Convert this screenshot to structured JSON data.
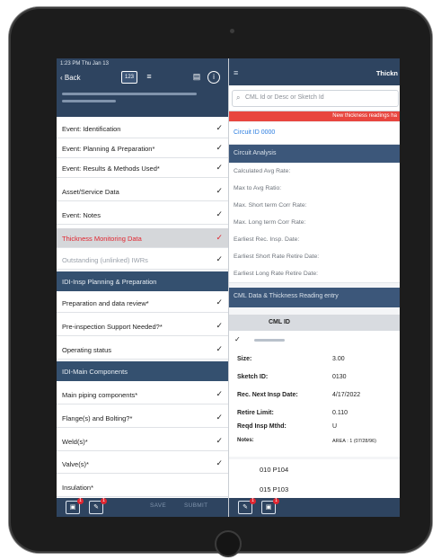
{
  "status_bar": {
    "time": "1:23 PM  Thu Jan 13"
  },
  "left_header": {
    "back_label": "‹ Back",
    "calendar_icon_text": "123",
    "list_icon": "list-icon",
    "doc_icon": "document-icon",
    "info_icon": "info-icon"
  },
  "nav_items": [
    {
      "label": "Event: Identification",
      "check": "✓"
    },
    {
      "label": "Event: Planning & Preparation*",
      "check": "✓"
    },
    {
      "label": "Event: Results & Methods Used*",
      "check": "✓"
    },
    {
      "label": "Asset/Service Data",
      "check": "✓"
    },
    {
      "label": "Event: Notes",
      "check": "✓"
    },
    {
      "label": "Thickness Monitoring Data",
      "check": "✓"
    },
    {
      "label": "Outstanding (unlinked) IWRs",
      "check": "✓"
    }
  ],
  "section_1": {
    "label": "IDI-Insp Planning & Preparation"
  },
  "nav_items_2": [
    {
      "label": "Preparation and data review*",
      "check": "✓"
    },
    {
      "label": "Pre-inspection Support Needed?*",
      "check": "✓"
    },
    {
      "label": "Operating status",
      "check": "✓"
    }
  ],
  "section_2": {
    "label": "IDI-Main Components"
  },
  "nav_items_3": [
    {
      "label": "Main piping components*",
      "check": "✓"
    },
    {
      "label": "Flange(s) and Bolting?*",
      "check": "✓"
    },
    {
      "label": "Weld(s)*",
      "check": "✓"
    },
    {
      "label": "Valve(s)*",
      "check": "✓"
    },
    {
      "label": "Insulation*",
      "check": ""
    }
  ],
  "left_footer": {
    "save": "SAVE",
    "submit": "SUBMIT",
    "badge_1": "1",
    "badge_2": "1"
  },
  "right_header": {
    "title": "Thickn"
  },
  "search": {
    "placeholder": "CML Id or Desc or Sketch Id"
  },
  "alert": {
    "text": "New thickness readings ha"
  },
  "circuit_analysis": {
    "header": "Circuit Analysis",
    "rows": [
      "Calculated Avg Rate:",
      "Max to Avg Ratio:",
      "Max. Short term Corr Rate:",
      "Max. Long term Corr Rate:",
      "Earliest Rec. Insp. Date:",
      "Earliest Short Rate Retire Date:",
      "Earliest Long Rate Retire Date:"
    ]
  },
  "cml_section": {
    "header": "CML Data & Thickness Reading entry",
    "column": "CML ID",
    "check": "✓"
  },
  "cml_detail": {
    "size_label": "Size:",
    "size_value": "3.00",
    "sketch_label": "Sketch ID:",
    "sketch_value": "0130",
    "next_label": "Rec. Next Insp Date:",
    "next_value": "4/17/2022",
    "retire_label": "Retire Limit:",
    "retire_value": "0.110",
    "method_label": "Reqd Insp Mthd:",
    "method_value": "U",
    "notes_label": "Notes:",
    "notes_value": "AREA : 1 (07/28/96)"
  },
  "cml_list": [
    "010  P104",
    "015  P103"
  ],
  "right_footer": {
    "badge_1": "1",
    "badge_2": "1"
  },
  "colors": {
    "header": "#2e4460",
    "active_text": "#e1252f",
    "alert": "#e8463f",
    "link": "#2b7de0"
  }
}
